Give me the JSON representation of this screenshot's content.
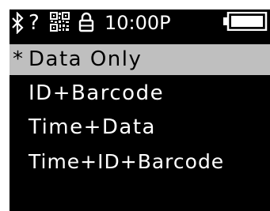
{
  "status_bar": {
    "bluetooth_icon": "bluetooth-icon",
    "unknown_status": "?",
    "qr_icon": "qr-code-icon",
    "lock_icon": "lock-icon",
    "time": "10:00P",
    "battery_icon": "battery-icon",
    "battery_level": 1.0
  },
  "menu": {
    "selected_marker": "*",
    "items": [
      {
        "label": "Data Only",
        "selected": true
      },
      {
        "label": "ID+Barcode",
        "selected": false
      },
      {
        "label": "Time+Data",
        "selected": false
      },
      {
        "label": "Time+ID+Barcode",
        "selected": false
      }
    ]
  },
  "colors": {
    "screen_background": "#000000",
    "text": "#ffffff",
    "highlight_background": "#bfbfbf",
    "highlight_text": "#000000"
  }
}
